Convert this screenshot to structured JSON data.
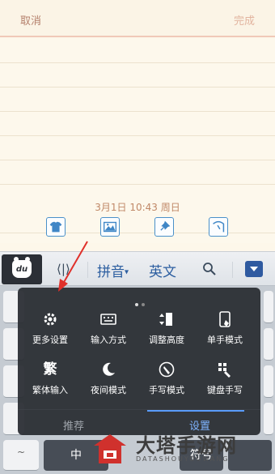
{
  "header": {
    "cancel_label": "取消",
    "done_label": "完成"
  },
  "note": {
    "date": "3月1日 10:43 周日",
    "tools": [
      "shirt-icon",
      "image-icon",
      "pin-icon",
      "clock-icon"
    ]
  },
  "keyboard_bar": {
    "logo_text": "du",
    "pinyin_label": "拼音",
    "english_label": "英文"
  },
  "settings_popup": {
    "page_dots": 2,
    "active_page": 1,
    "items": [
      {
        "label": "更多设置",
        "icon": "gear-icon"
      },
      {
        "label": "输入方式",
        "icon": "keyboard-icon"
      },
      {
        "label": "调整高度",
        "icon": "height-icon"
      },
      {
        "label": "单手模式",
        "icon": "one-hand-icon"
      },
      {
        "label": "繁体输入",
        "icon": "traditional-icon",
        "glyph": "繁"
      },
      {
        "label": "夜间模式",
        "icon": "moon-icon"
      },
      {
        "label": "手写模式",
        "icon": "handwrite-icon"
      },
      {
        "label": "键盘手写",
        "icon": "keyboard-handwrite-icon"
      }
    ],
    "tabs": [
      {
        "label": "推荐",
        "active": false
      },
      {
        "label": "设置",
        "active": true
      }
    ]
  },
  "bottom_row": {
    "zhong_label": "中",
    "symbol_label": "符号"
  },
  "watermark": {
    "title": "大塔手游网",
    "subtitle": "DATASHOUYOUWANG"
  },
  "colors": {
    "accent": "#2c5ea0",
    "popup_bg": "#282b30",
    "active_tab": "#7fb4ff",
    "arrow": "#e0302a"
  }
}
